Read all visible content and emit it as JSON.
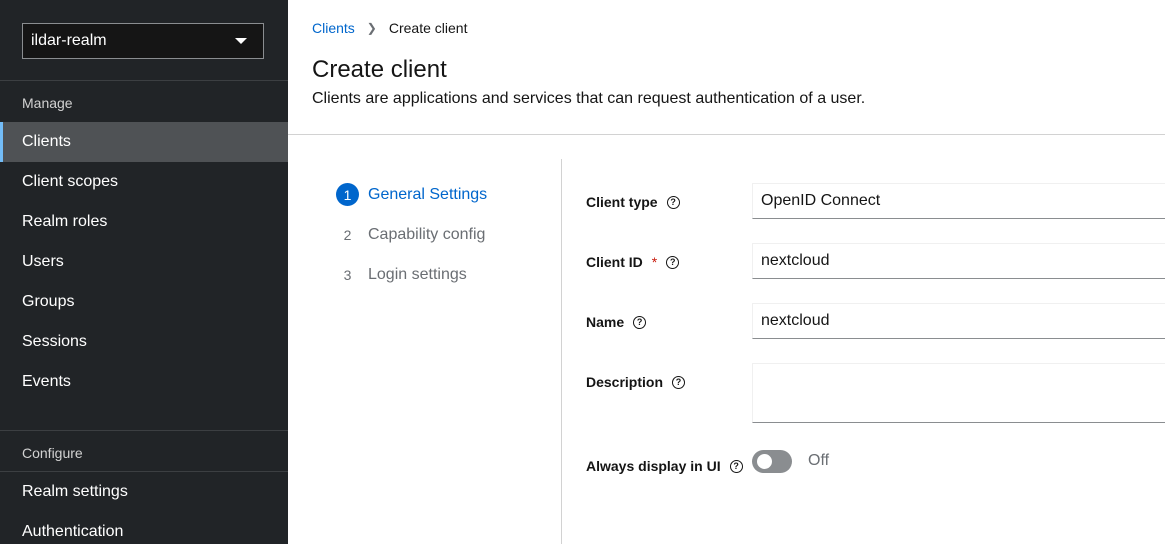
{
  "sidebar": {
    "realm": "ildar-realm",
    "manage_title": "Manage",
    "manage_items": [
      {
        "label": "Clients",
        "active": true
      },
      {
        "label": "Client scopes"
      },
      {
        "label": "Realm roles"
      },
      {
        "label": "Users"
      },
      {
        "label": "Groups"
      },
      {
        "label": "Sessions"
      },
      {
        "label": "Events"
      }
    ],
    "configure_title": "Configure",
    "configure_items": [
      {
        "label": "Realm settings"
      },
      {
        "label": "Authentication"
      }
    ]
  },
  "breadcrumb": {
    "parent": "Clients",
    "current": "Create client"
  },
  "page": {
    "title": "Create client",
    "description": "Clients are applications and services that can request authentication of a user."
  },
  "wizard": {
    "steps": [
      {
        "num": "1",
        "label": "General Settings",
        "current": true
      },
      {
        "num": "2",
        "label": "Capability config"
      },
      {
        "num": "3",
        "label": "Login settings"
      }
    ]
  },
  "form": {
    "client_type": {
      "label": "Client type",
      "value": "OpenID Connect"
    },
    "client_id": {
      "label": "Client ID",
      "required_mark": "*",
      "value": "nextcloud"
    },
    "name": {
      "label": "Name",
      "value": "nextcloud"
    },
    "description": {
      "label": "Description",
      "value": ""
    },
    "always_display": {
      "label": "Always display in UI",
      "state": "Off"
    }
  },
  "colors": {
    "sidebar_bg": "#212427",
    "accent": "#0066cc",
    "active_nav": "#4f5255",
    "required": "#c9190b"
  }
}
